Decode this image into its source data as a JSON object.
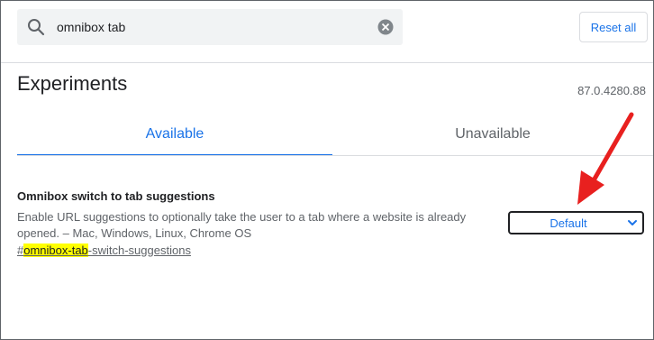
{
  "search": {
    "value": "omnibox tab",
    "icon": "search-icon"
  },
  "toolbar": {
    "reset_label": "Reset all"
  },
  "page": {
    "title": "Experiments",
    "version": "87.0.4280.88"
  },
  "tabs": [
    {
      "label": "Available",
      "active": true
    },
    {
      "label": "Unavailable",
      "active": false
    }
  ],
  "experiment": {
    "name": "Omnibox switch to tab suggestions",
    "description": "Enable URL suggestions to optionally take the user to a tab where a website is already opened. – Mac, Windows, Linux, Chrome OS",
    "link_prefix": "#",
    "link_highlight": "omnibox-tab",
    "link_suffix": "-switch-suggestions",
    "selected_option": "Default"
  },
  "colors": {
    "accent": "#1a73e8",
    "annotation_arrow": "#e8201f",
    "highlight": "#ffff00"
  }
}
